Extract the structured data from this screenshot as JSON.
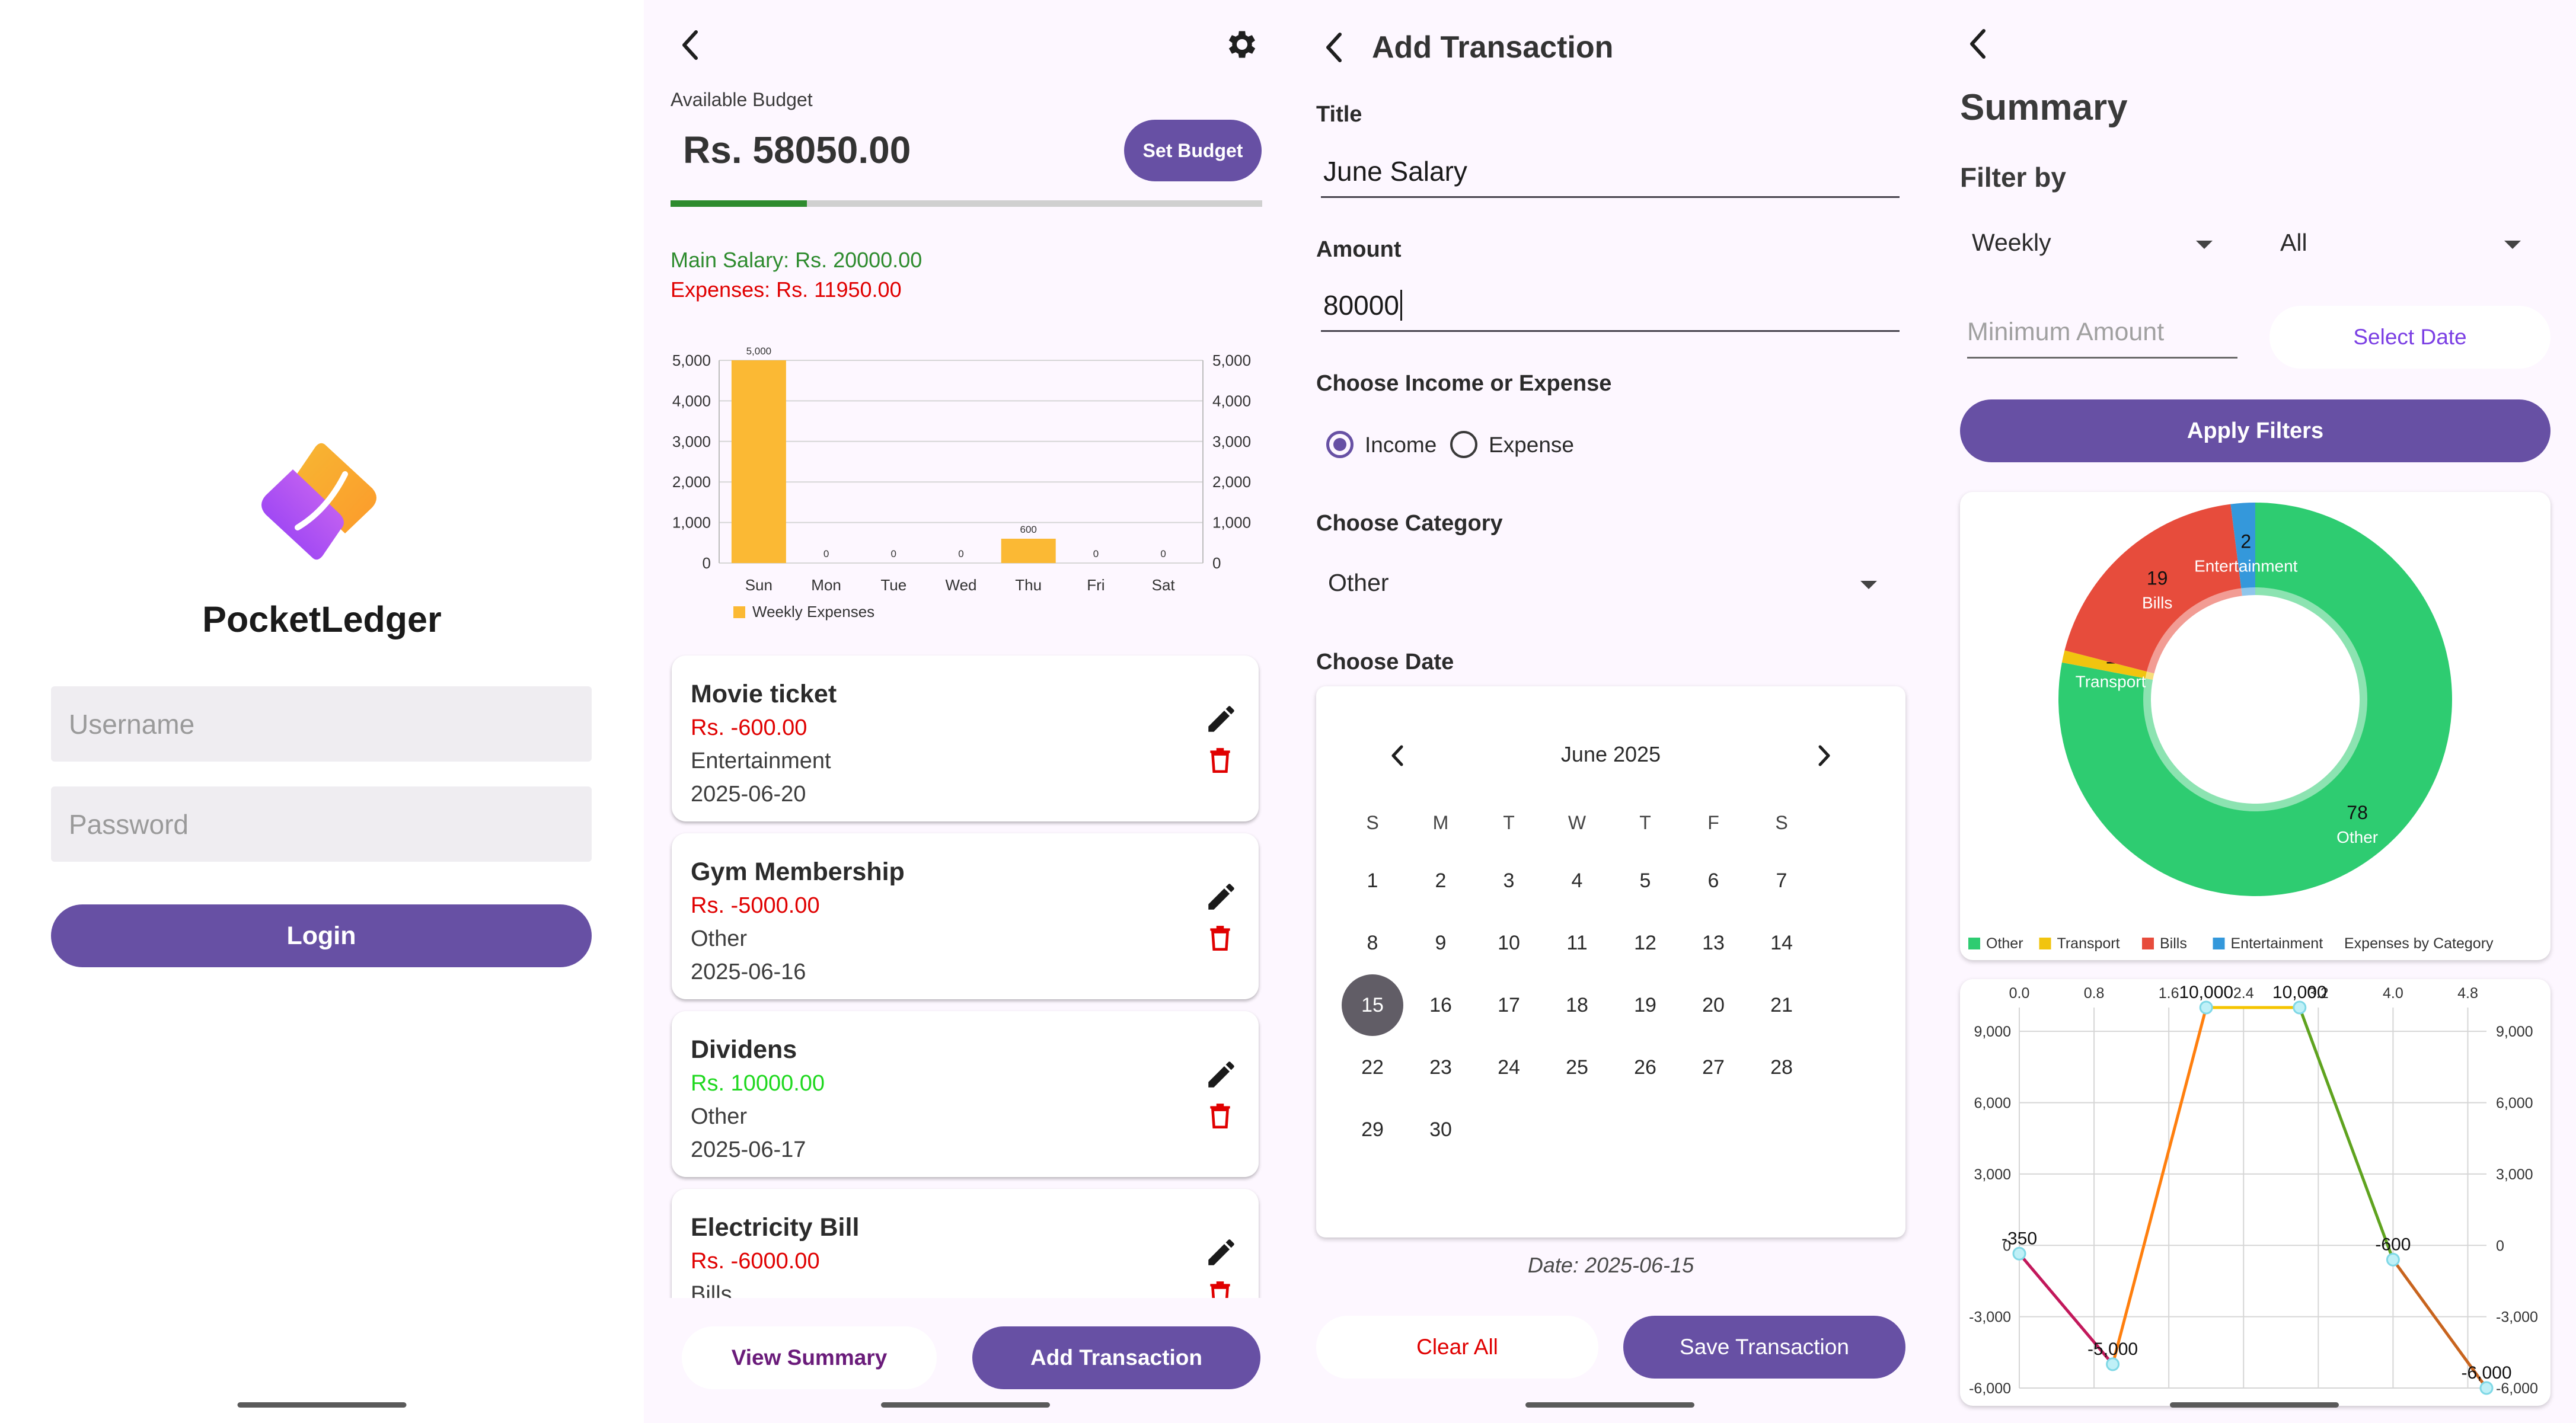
{
  "login": {
    "app_name": "PocketLedger",
    "username_placeholder": "Username",
    "password_placeholder": "Password",
    "login_label": "Login"
  },
  "dashboard": {
    "available_budget_label": "Available Budget",
    "available_budget_value": "Rs. 58050.00",
    "budget_progress_fraction": 0.23,
    "set_budget_label": "Set Budget",
    "main_salary_text": "Main Salary: Rs. 20000.00",
    "expenses_text": "Expenses: Rs. 11950.00",
    "transactions": [
      {
        "title": "Movie ticket",
        "amount": "Rs. -600.00",
        "category": "Entertainment",
        "date": "2025-06-20",
        "type": "expense"
      },
      {
        "title": "Gym Membership",
        "amount": "Rs. -5000.00",
        "category": "Other",
        "date": "2025-06-16",
        "type": "expense"
      },
      {
        "title": "Dividens",
        "amount": "Rs. 10000.00",
        "category": "Other",
        "date": "2025-06-17",
        "type": "income"
      },
      {
        "title": "Electricity Bill",
        "amount": "Rs. -6000.00",
        "category": "Bills",
        "date": "",
        "type": "expense"
      }
    ],
    "view_summary_label": "View Summary",
    "add_transaction_label": "Add Transaction",
    "colors": {
      "income": "#1fd81f",
      "expense": "#e00000",
      "salary": "#2e8b2e",
      "bar": "#fbb934",
      "accent": "#6750a4"
    }
  },
  "add_transaction": {
    "header_title": "Add Transaction",
    "title_label": "Title",
    "title_value": "June Salary",
    "amount_label": "Amount",
    "amount_value": "80000",
    "type_label": "Choose Income or Expense",
    "income_label": "Income",
    "expense_label": "Expense",
    "selected_type": "Income",
    "category_label": "Choose Category",
    "category_value": "Other",
    "date_label": "Choose Date",
    "calendar": {
      "month_label": "June 2025",
      "weekdays": [
        "S",
        "M",
        "T",
        "W",
        "T",
        "F",
        "S"
      ],
      "first_weekday_index": 0,
      "days_in_month": 30,
      "selected_day": 15
    },
    "date_text": "Date: 2025-06-15",
    "clear_all_label": "Clear All",
    "save_label": "Save Transaction"
  },
  "summary": {
    "title": "Summary",
    "filter_by_label": "Filter by",
    "period_value": "Weekly",
    "category_filter_value": "All",
    "min_amount_placeholder": "Minimum Amount",
    "select_date_label": "Select Date",
    "apply_filters_label": "Apply Filters",
    "donut_legend_title": "Expenses by Category"
  },
  "chart_data": [
    {
      "type": "bar",
      "categories": [
        "Sun",
        "Mon",
        "Tue",
        "Wed",
        "Thu",
        "Fri",
        "Sat"
      ],
      "series": [
        {
          "name": "Weekly Expenses",
          "values": [
            5000,
            0,
            0,
            0,
            600,
            0,
            0
          ]
        }
      ],
      "data_labels": [
        "5,000",
        "0",
        "0",
        "0",
        "600",
        "0",
        "0"
      ],
      "yticks": [
        "0",
        "1,000",
        "2,000",
        "3,000",
        "4,000",
        "5,000"
      ],
      "ylim": [
        0,
        5000
      ],
      "legend": "bottom-left",
      "grid": true
    },
    {
      "type": "pie",
      "labels": [
        "Other",
        "Transport",
        "Bills",
        "Entertainment"
      ],
      "values": [
        78,
        1,
        19,
        2
      ],
      "colors": [
        "#2ecc71",
        "#f1c40f",
        "#e74c3c",
        "#3498db"
      ],
      "legend": "bottom",
      "legend_title": "Expenses by Category"
    },
    {
      "type": "line",
      "x": [
        0.0,
        1.0,
        2.0,
        3.0,
        4.0,
        5.0
      ],
      "y": [
        -350,
        -5000,
        10000,
        10000,
        -600,
        -6000
      ],
      "point_labels": [
        "-350",
        "-5,000",
        "10,000",
        "10,000",
        "-600",
        "-6,000"
      ],
      "xticks": [
        "0.0",
        "0.8",
        "1.6",
        "2.4",
        "3.2",
        "4.0",
        "4.8"
      ],
      "yticks": [
        "-6,000",
        "-3,000",
        "0",
        "3,000",
        "6,000",
        "9,000"
      ],
      "xlim": [
        0,
        5
      ],
      "ylim": [
        -6000,
        10000
      ],
      "segment_colors": [
        "#c2185b",
        "#ff7f0e",
        "#f5c400",
        "#5fa31f",
        "#c8641e"
      ],
      "grid": true
    }
  ]
}
